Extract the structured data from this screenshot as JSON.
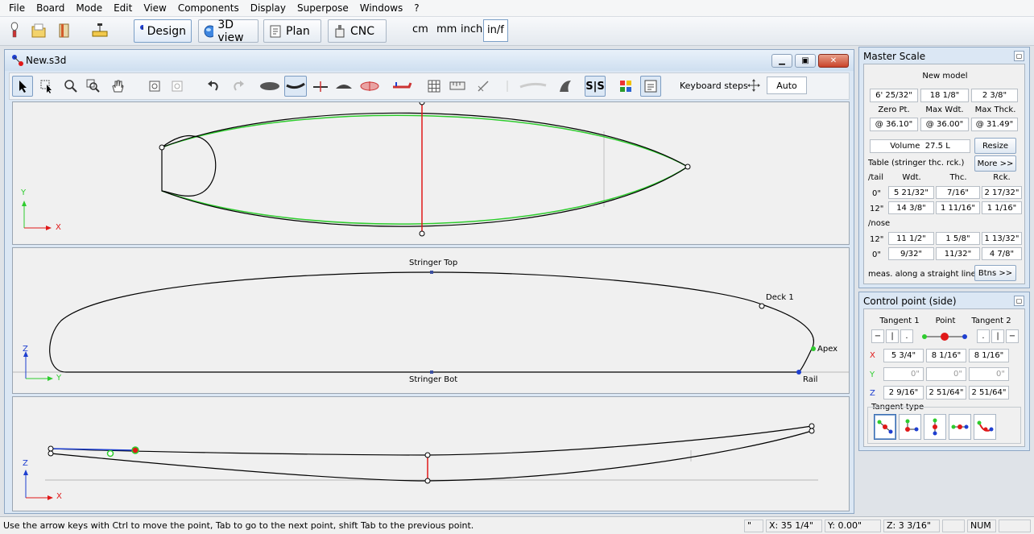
{
  "menu": [
    "File",
    "Board",
    "Mode",
    "Edit",
    "View",
    "Components",
    "Display",
    "Superpose",
    "Windows",
    "?"
  ],
  "modes": {
    "design": "Design",
    "view3d": "3D view",
    "plan": "Plan",
    "cnc": "CNC"
  },
  "units": {
    "cm": "cm",
    "mm": "mm",
    "inch": "inch",
    "inf": "in/f"
  },
  "document": {
    "title": "New.s3d"
  },
  "toolbar": {
    "keyboard_steps_label": "Keyboard steps",
    "steps_value": "Auto"
  },
  "side_view": {
    "top_label": "Stringer Top",
    "bot_label": "Stringer Bot",
    "deck_label": "Deck 1",
    "apex_label": "Apex",
    "rail_label": "Rail"
  },
  "axes": {
    "x": "X",
    "y": "Y",
    "z": "Z"
  },
  "master_scale": {
    "title": "Master Scale",
    "model_name": "New model",
    "dims": [
      "6' 25/32\"",
      "18 1/8\"",
      "2 3/8\""
    ],
    "headers": [
      "Zero Pt.",
      "Max Wdt.",
      "Max Thck."
    ],
    "positions": [
      "@ 36.10\"",
      "@ 36.00\"",
      "@ 31.49\""
    ],
    "volume_label": "Volume",
    "volume_value": "27.5 L",
    "resize": "Resize",
    "more": "More >>",
    "table_title": "Table (stringer thc. rck.)",
    "tail_label": "/tail",
    "nose_label": "/nose",
    "col_headers": [
      "Wdt.",
      "Thc.",
      "Rck."
    ],
    "rows": [
      {
        "pos": "0\"",
        "w": "5 21/32\"",
        "t": "7/16\"",
        "r": "2 17/32\""
      },
      {
        "pos": "12\"",
        "w": "14 3/8\"",
        "t": "1 11/16\"",
        "r": "1 1/16\""
      },
      {
        "pos": "12\"",
        "w": "11 1/2\"",
        "t": "1 5/8\"",
        "r": "1 13/32\""
      },
      {
        "pos": "0\"",
        "w": "9/32\"",
        "t": "11/32\"",
        "r": "4 7/8\""
      }
    ],
    "note": "meas. along a straight line",
    "btns": "Btns >>"
  },
  "control_point": {
    "title": "Control point (side)",
    "tangent1": "Tangent 1",
    "point": "Point",
    "tangent2": "Tangent 2",
    "x": [
      "5 3/4\"",
      "8 1/16\"",
      "8 1/16\""
    ],
    "y": [
      "0\"",
      "0\"",
      "0\""
    ],
    "z": [
      "2 9/16\"",
      "2 51/64\"",
      "2 51/64\""
    ],
    "tangent_type": "Tangent type"
  },
  "status": {
    "message": "Use the arrow keys with Ctrl to move the point, Tab to go to the next point, shift Tab to the previous point.",
    "mark": "\"",
    "x": "X: 35 1/4\"",
    "y": "Y: 0.00\"",
    "z": "Z: 3 3/16\"",
    "num": "NUM"
  },
  "colors": {
    "outline": "#000000",
    "ghost_outline": "#2ecc2e",
    "stringer": "#e01818",
    "handle": "#1e3fd0",
    "panel_bg": "#f0f0f0"
  },
  "icons": {
    "new": "lamp-icon",
    "open": "folder-icon",
    "save": "book-icon",
    "print": "scale-icon"
  }
}
